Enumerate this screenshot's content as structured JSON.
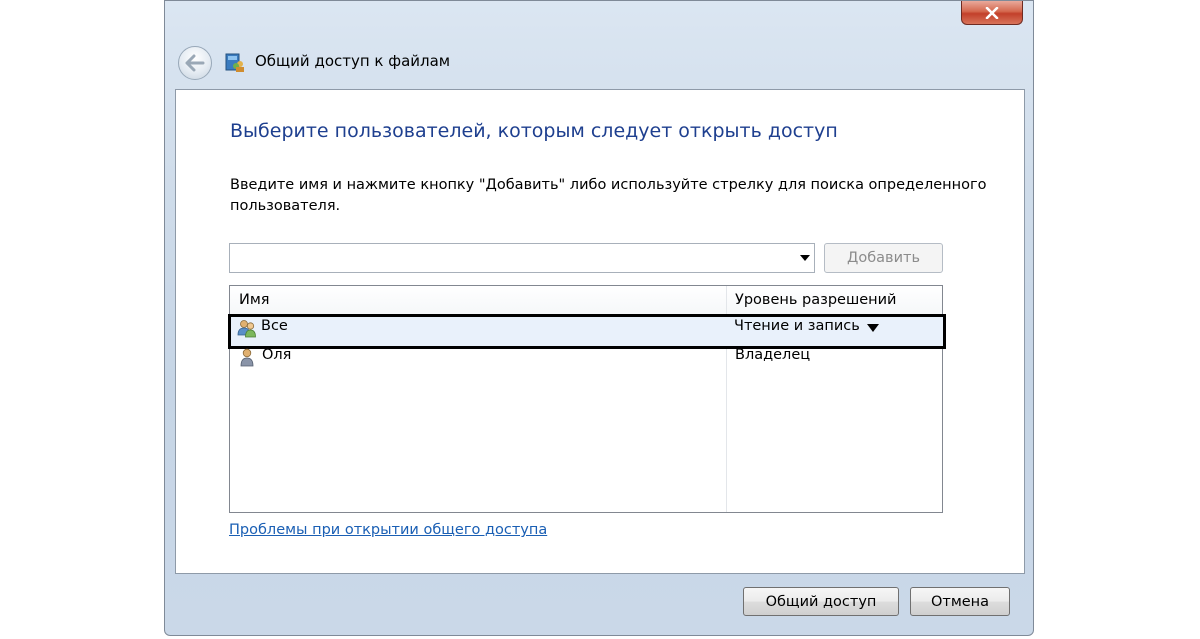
{
  "window": {
    "title": "Общий доступ к файлам",
    "close_icon": "close-icon",
    "back_icon": "back-arrow-icon"
  },
  "main": {
    "heading": "Выберите пользователей, которым следует открыть доступ",
    "instruction": "Введите имя и нажмите кнопку \"Добавить\" либо используйте стрелку для поиска определенного пользователя.",
    "user_input": {
      "value": "",
      "placeholder": ""
    },
    "add_button": "Добавить",
    "list": {
      "columns": [
        "Имя",
        "Уровень разрешений"
      ],
      "rows": [
        {
          "name": "Все",
          "permission": "Чтение и запись",
          "icon": "users-group-icon",
          "selected": true
        },
        {
          "name": "Оля",
          "permission": "Владелец",
          "icon": "user-icon",
          "selected": false
        }
      ]
    },
    "help_link": "Проблемы при открытии общего доступа"
  },
  "footer": {
    "share_button": "Общий доступ",
    "cancel_button": "Отмена"
  },
  "colors": {
    "heading": "#1e3f8f",
    "link": "#1a5fb4",
    "close_button": "#c2402a"
  }
}
